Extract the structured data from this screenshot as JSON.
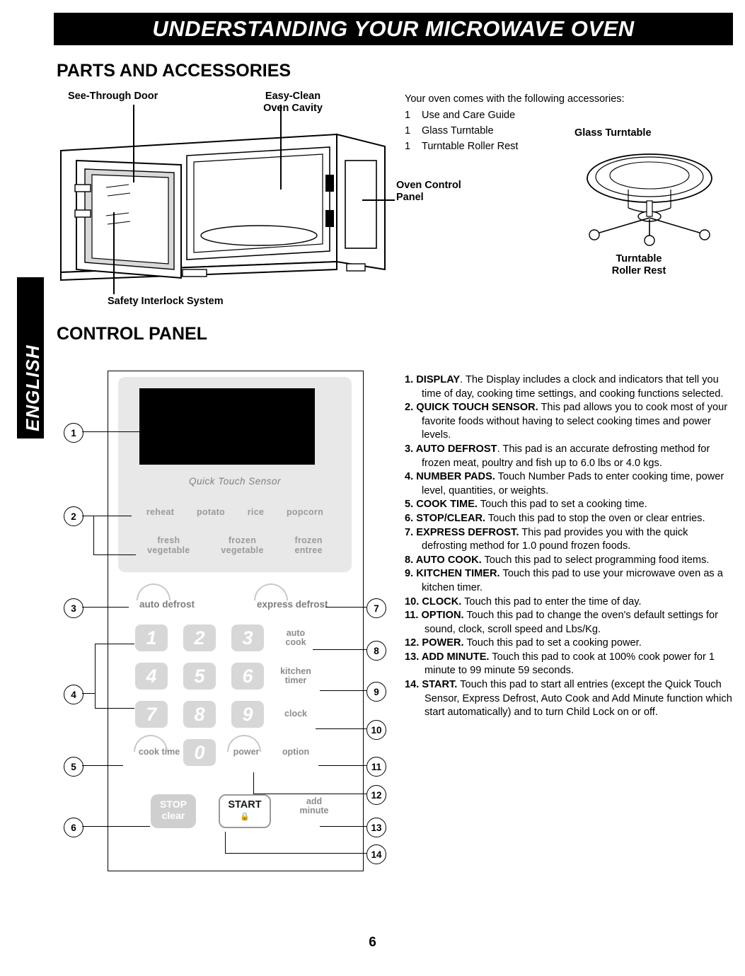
{
  "header": {
    "title": "UNDERSTANDING YOUR MICROWAVE OVEN"
  },
  "side_tab": {
    "label": "ENGLISH"
  },
  "sections": {
    "parts_title": "PARTS AND ACCESSORIES",
    "control_title": "CONTROL PANEL"
  },
  "parts_labels": {
    "see_through_door": "See-Through Door",
    "easy_clean": "Easy-Clean",
    "oven_cavity": "Oven Cavity",
    "safety_interlock": "Safety Interlock System",
    "oven_control": "Oven Control",
    "panel": "Panel",
    "glass_turntable": "Glass Turntable",
    "turntable": "Turntable",
    "roller_rest": "Roller Rest"
  },
  "accessories": {
    "intro": "Your oven comes with the following accessories:",
    "items": [
      {
        "qty": "1",
        "name": "Use and Care Guide"
      },
      {
        "qty": "1",
        "name": "Glass Turntable"
      },
      {
        "qty": "1",
        "name": "Turntable Roller Rest"
      }
    ]
  },
  "control_panel": {
    "quick_touch_label": "Quick Touch Sensor",
    "sensor_row1": [
      "reheat",
      "potato",
      "rice",
      "popcorn"
    ],
    "sensor_row2": [
      "fresh\nvegetable",
      "frozen\nvegetable",
      "frozen\nentree"
    ],
    "sensor_row2_lines": [
      [
        "fresh",
        "vegetable"
      ],
      [
        "frozen",
        "vegetable"
      ],
      [
        "frozen",
        "entree"
      ]
    ],
    "auto_defrost": "auto defrost",
    "express_defrost": "express defrost",
    "numbers": [
      "1",
      "2",
      "3",
      "4",
      "5",
      "6",
      "7",
      "8",
      "9",
      "0"
    ],
    "auto_cook": [
      "auto",
      "cook"
    ],
    "kitchen_timer": [
      "kitchen",
      "timer"
    ],
    "clock": "clock",
    "cook_time": "cook time",
    "power": "power",
    "option": "option",
    "stop": "STOP",
    "clear": "clear",
    "start": "START",
    "add_minute": [
      "add",
      "minute"
    ],
    "callouts": [
      "1",
      "2",
      "3",
      "4",
      "5",
      "6",
      "7",
      "8",
      "9",
      "10",
      "11",
      "12",
      "13",
      "14"
    ]
  },
  "descriptions": [
    {
      "num": "1.",
      "term": "DISPLAY",
      "text": ". The Display includes a clock and indicators that tell you time of day, cooking time settings, and cooking functions selected."
    },
    {
      "num": "2.",
      "term": "QUICK TOUCH SENSOR.",
      "text": " This pad allows you to cook most of your favorite foods without having to select cooking times and power levels."
    },
    {
      "num": "3.",
      "term": "AUTO DEFROST",
      "text": ". This pad is an accurate defrosting method for frozen meat, poultry and fish up to 6.0 lbs or 4.0 kgs."
    },
    {
      "num": "4.",
      "term": "NUMBER PADS.",
      "text": " Touch Number Pads to enter cooking time, power level, quantities, or weights."
    },
    {
      "num": "5.",
      "term": "COOK TIME.",
      "text": " Touch this pad to set a cooking time."
    },
    {
      "num": "6.",
      "term": "STOP/CLEAR.",
      "text": " Touch this pad to stop the oven or clear entries."
    },
    {
      "num": "7.",
      "term": "EXPRESS DEFROST.",
      "text": " This pad provides you with the quick defrosting method for 1.0 pound frozen foods."
    },
    {
      "num": "8.",
      "term": "AUTO COOK.",
      "text": " Touch this pad to select programming food items."
    },
    {
      "num": "9.",
      "term": "KITCHEN TIMER.",
      "text": " Touch this pad to use your microwave oven as a kitchen timer."
    },
    {
      "num": "10.",
      "term": "CLOCK.",
      "text": " Touch this pad to enter the time of day."
    },
    {
      "num": "11.",
      "term": "OPTION.",
      "text": " Touch this pad to change the oven's default settings for sound, clock, scroll speed and Lbs/Kg."
    },
    {
      "num": "12.",
      "term": "POWER.",
      "text": " Touch this pad to set a cooking power."
    },
    {
      "num": "13.",
      "term": "ADD MINUTE.",
      "text": " Touch this pad to cook at 100% cook power for 1 minute to 99 minute 59 seconds."
    },
    {
      "num": "14.",
      "term": "START.",
      "text": " Touch this pad to start all entries (except the Quick Touch Sensor, Express Defrost, Auto Cook and Add Minute function which start automatically) and to turn Child Lock on or off."
    }
  ],
  "page": {
    "number": "6"
  }
}
